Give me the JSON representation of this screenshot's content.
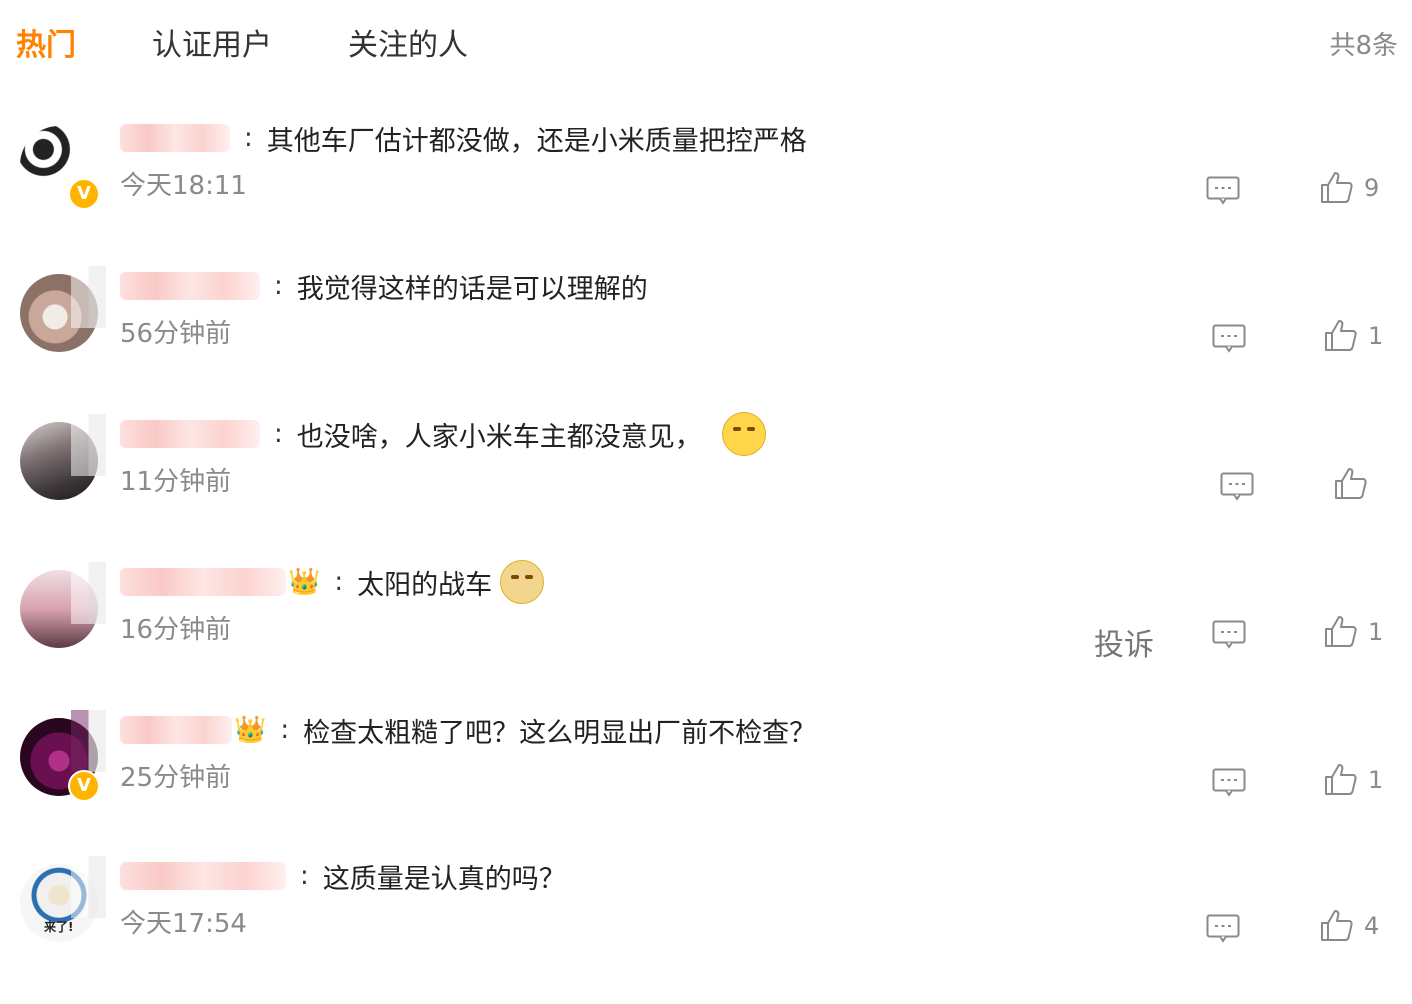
{
  "tabs": [
    {
      "label": "热门",
      "active": true
    },
    {
      "label": "认证用户",
      "active": false
    },
    {
      "label": "关注的人",
      "active": false
    }
  ],
  "total_count": "共8条",
  "accent_color": "#ff8200",
  "comments": [
    {
      "text": "其他车厂估计都没做，还是小米质量把控严格",
      "time": "今天18:11",
      "likes": "9",
      "verified": true,
      "crown": false,
      "emoji": false,
      "avatar_colors": [
        "#333333",
        "#dddddd"
      ]
    },
    {
      "text": "我觉得这样的话是可以理解的",
      "time": "56分钟前",
      "likes": "1",
      "verified": false,
      "crown": false,
      "emoji": false,
      "avatar_colors": [
        "#c9a79a",
        "#eadfd6"
      ]
    },
    {
      "text": "也没啥，人家小米车主都没意见，",
      "time": "11分钟前",
      "likes": "",
      "verified": false,
      "crown": false,
      "emoji": true,
      "avatar_colors": [
        "#3a3436",
        "#7a6e70"
      ]
    },
    {
      "text": "太阳的战车",
      "time": "16分钟前",
      "likes": "1",
      "verified": false,
      "crown": true,
      "emoji": true,
      "report": "投诉",
      "avatar_colors": [
        "#d8a2b0",
        "#efe0e4"
      ]
    },
    {
      "text": "检查太粗糙了吧？这么明显出厂前不检查？",
      "time": "25分钟前",
      "likes": "1",
      "verified": true,
      "crown": true,
      "emoji": false,
      "avatar_colors": [
        "#6a1050",
        "#2a0620"
      ]
    },
    {
      "text": "这质量是认真的吗？",
      "time": "今天17:54",
      "likes": "4",
      "verified": false,
      "crown": false,
      "emoji": false,
      "avatar_colors": [
        "#f0f0f0",
        "#2c6fb0"
      ],
      "avatar_caption": "来了!"
    }
  ],
  "icons": {
    "reply": "comment-bubble-icon",
    "like": "thumbs-up-icon",
    "verified": "verified-v-badge-icon",
    "crown": "crown-badge-icon"
  },
  "verified_letter": "V",
  "crown_glyph": "👑"
}
